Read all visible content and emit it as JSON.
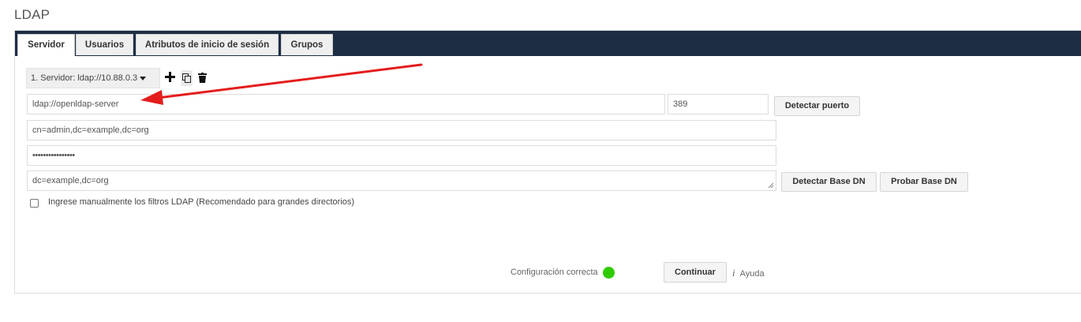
{
  "page": {
    "title": "LDAP"
  },
  "tabs": [
    {
      "label": "Servidor",
      "active": true
    },
    {
      "label": "Usuarios",
      "active": false
    },
    {
      "label": "Atributos de inicio de sesión",
      "active": false
    },
    {
      "label": "Grupos",
      "active": false
    }
  ],
  "server": {
    "select_label": "1. Servidor: ldap://10.88.0.3",
    "add_icon": "plus-icon",
    "copy_icon": "copy-icon",
    "delete_icon": "trash-icon"
  },
  "form": {
    "host": {
      "value": "ldap://openldap-server"
    },
    "port": {
      "value": "389"
    },
    "detect_port_label": "Detectar puerto",
    "user_dn": {
      "value": "cn=admin,dc=example,dc=org"
    },
    "password": {
      "value": "••••••••••••••••"
    },
    "base_dn": {
      "value": "dc=example,dc=org"
    },
    "detect_base_dn_label": "Detectar Base DN",
    "test_base_dn_label": "Probar Base DN",
    "manual_filter": {
      "label": "Ingrese manualmente los filtros LDAP (Recomendado para grandes directorios)",
      "checked": false
    }
  },
  "footer": {
    "status_text": "Configuración correcta",
    "status_color": "#2fcb00",
    "continue_label": "Continuar",
    "help_label": "Ayuda"
  },
  "colors": {
    "tabbar_bg": "#1d2d44",
    "annotation_arrow": "#e41c1c"
  }
}
